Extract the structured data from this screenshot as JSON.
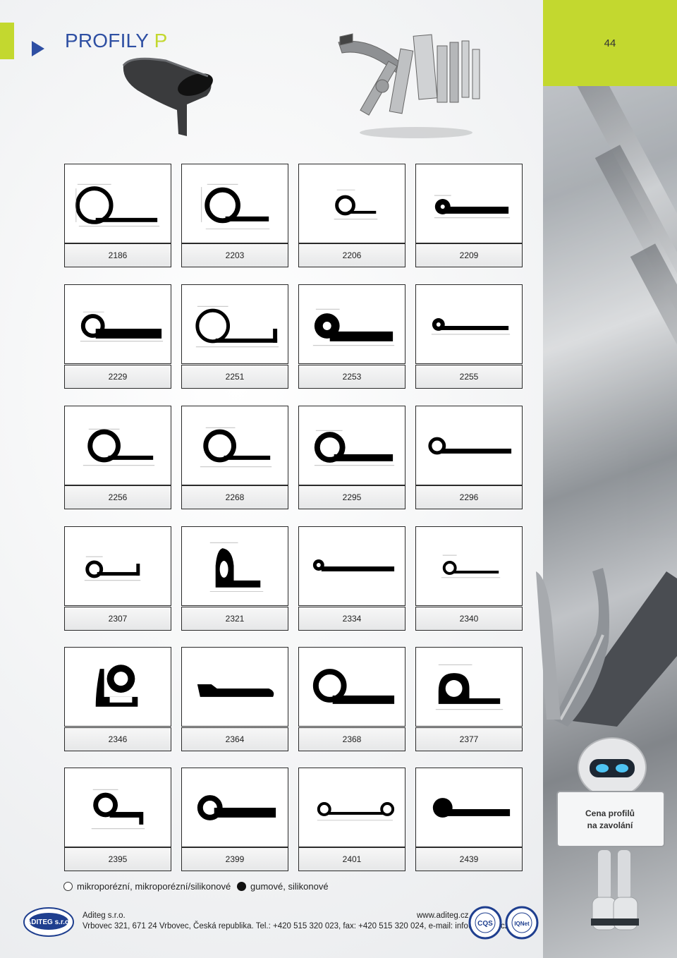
{
  "page": {
    "title_main": "PROFILY",
    "title_accent": "P",
    "page_number": "44"
  },
  "colors": {
    "accent_green": "#c3d82f",
    "title_blue": "#2e4fa3"
  },
  "profiles": [
    {
      "code": "2186"
    },
    {
      "code": "2203"
    },
    {
      "code": "2206"
    },
    {
      "code": "2209"
    },
    {
      "code": "2229"
    },
    {
      "code": "2251"
    },
    {
      "code": "2253"
    },
    {
      "code": "2255"
    },
    {
      "code": "2256"
    },
    {
      "code": "2268"
    },
    {
      "code": "2295"
    },
    {
      "code": "2296"
    },
    {
      "code": "2307"
    },
    {
      "code": "2321"
    },
    {
      "code": "2334"
    },
    {
      "code": "2340"
    },
    {
      "code": "2346"
    },
    {
      "code": "2364"
    },
    {
      "code": "2368"
    },
    {
      "code": "2377"
    },
    {
      "code": "2395"
    },
    {
      "code": "2399"
    },
    {
      "code": "2401"
    },
    {
      "code": "2439"
    }
  ],
  "legend": {
    "porous": "mikroporézní, mikroporézní/silikonové",
    "rubber": "gumové, silikonové"
  },
  "robot_sign": {
    "line1": "Cena profilů",
    "line2": "na zavolání"
  },
  "footer": {
    "company": "Aditeg s.r.o.",
    "address": "Vrbovec 321, 671 24  Vrbovec, Česká republika. Tel.: +420 515 320 023, fax: +420 515 320 024, e-mail: info@aditeg.cz",
    "website": "www.aditeg.cz",
    "logo_text": "ADITEG s.r.o.",
    "cert1_text": "CQS",
    "cert2_text": "IQNet"
  }
}
